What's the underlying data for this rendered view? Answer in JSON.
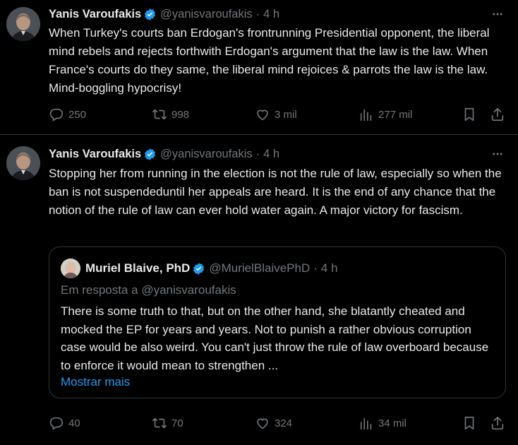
{
  "colors": {
    "background": "#000000",
    "text": "#e7e9ea",
    "muted": "#71767b",
    "accent": "#1d9bf0",
    "border": "#2f3336"
  },
  "tweets": [
    {
      "author": {
        "name": "Yanis Varoufakis",
        "handle": "@yanisvaroufakis",
        "verified": true
      },
      "separator": "·",
      "time": "4 h",
      "text": "When Turkey's courts ban Erdogan's frontrunning Presidential opponent, the liberal mind rebels and rejects forthwith Erdogan's argument that the law is the law. When France's courts do they same, the liberal mind rejoices & parrots the law is the law. Mind-boggling hypocrisy!",
      "stats": {
        "replies": "250",
        "reposts": "998",
        "likes": "3 mil",
        "views": "277 mil"
      }
    },
    {
      "author": {
        "name": "Yanis Varoufakis",
        "handle": "@yanisvaroufakis",
        "verified": true
      },
      "separator": "·",
      "time": "4 h",
      "text": "Stopping her from running in the election is not the rule of law, especially so when the ban is not suspendeduntil her appeals are heard. It is the end of any chance that the notion of the rule of law can ever hold water again. A major victory for fascism.",
      "quote": {
        "author": {
          "name": "Muriel Blaive, PhD",
          "handle": "@MurielBlaivePhD",
          "verified": true
        },
        "separator": "·",
        "time": "4 h",
        "reply_to": "Em resposta a @yanisvaroufakis",
        "text": "There is some truth to that, but on the other hand, she blatantly cheated and mocked the EP for years and years. Not to punish a rather obvious corruption case would be also weird. You can't just throw the rule of law overboard because to enforce it would mean to strengthen ...",
        "show_more": "Mostrar mais"
      },
      "stats": {
        "replies": "40",
        "reposts": "70",
        "likes": "324",
        "views": "34 mil"
      }
    }
  ]
}
